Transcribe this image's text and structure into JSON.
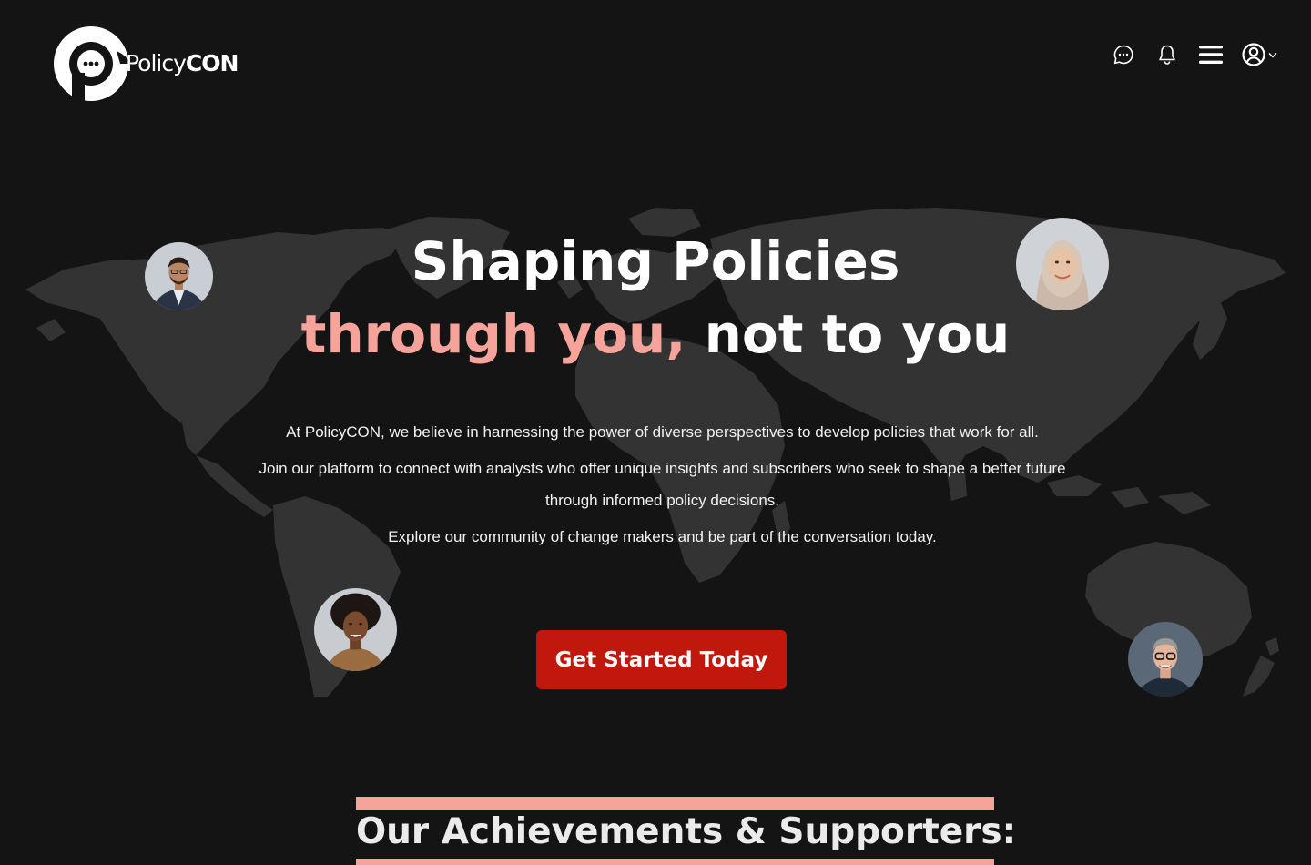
{
  "header": {
    "brand_light": "Policy",
    "brand_bold": "CON",
    "icons": [
      "chat-bubble-icon",
      "bell-icon",
      "hamburger-menu-icon",
      "user-circle-icon",
      "chevron-down-icon"
    ]
  },
  "hero": {
    "title_line1": "Shaping Policies",
    "title_line2_highlight": "through you,",
    "title_line2_rest": " not to you",
    "paragraph1": "At PolicyCON, we believe in harnessing the power of diverse perspectives to develop policies that work for all.",
    "paragraph2": "Join our platform to connect with analysts who offer unique insights and subscribers who seek to shape a better future through informed policy decisions.",
    "paragraph3": "Explore our community of change makers and be part of the conversation today.",
    "cta_label": "Get Started Today"
  },
  "section": {
    "title": "Our Achievements & Supporters:"
  },
  "colors": {
    "background": "#141414",
    "map": "#333333",
    "accent_pink": "#f5a39b",
    "cta_red": "#c1180d"
  }
}
